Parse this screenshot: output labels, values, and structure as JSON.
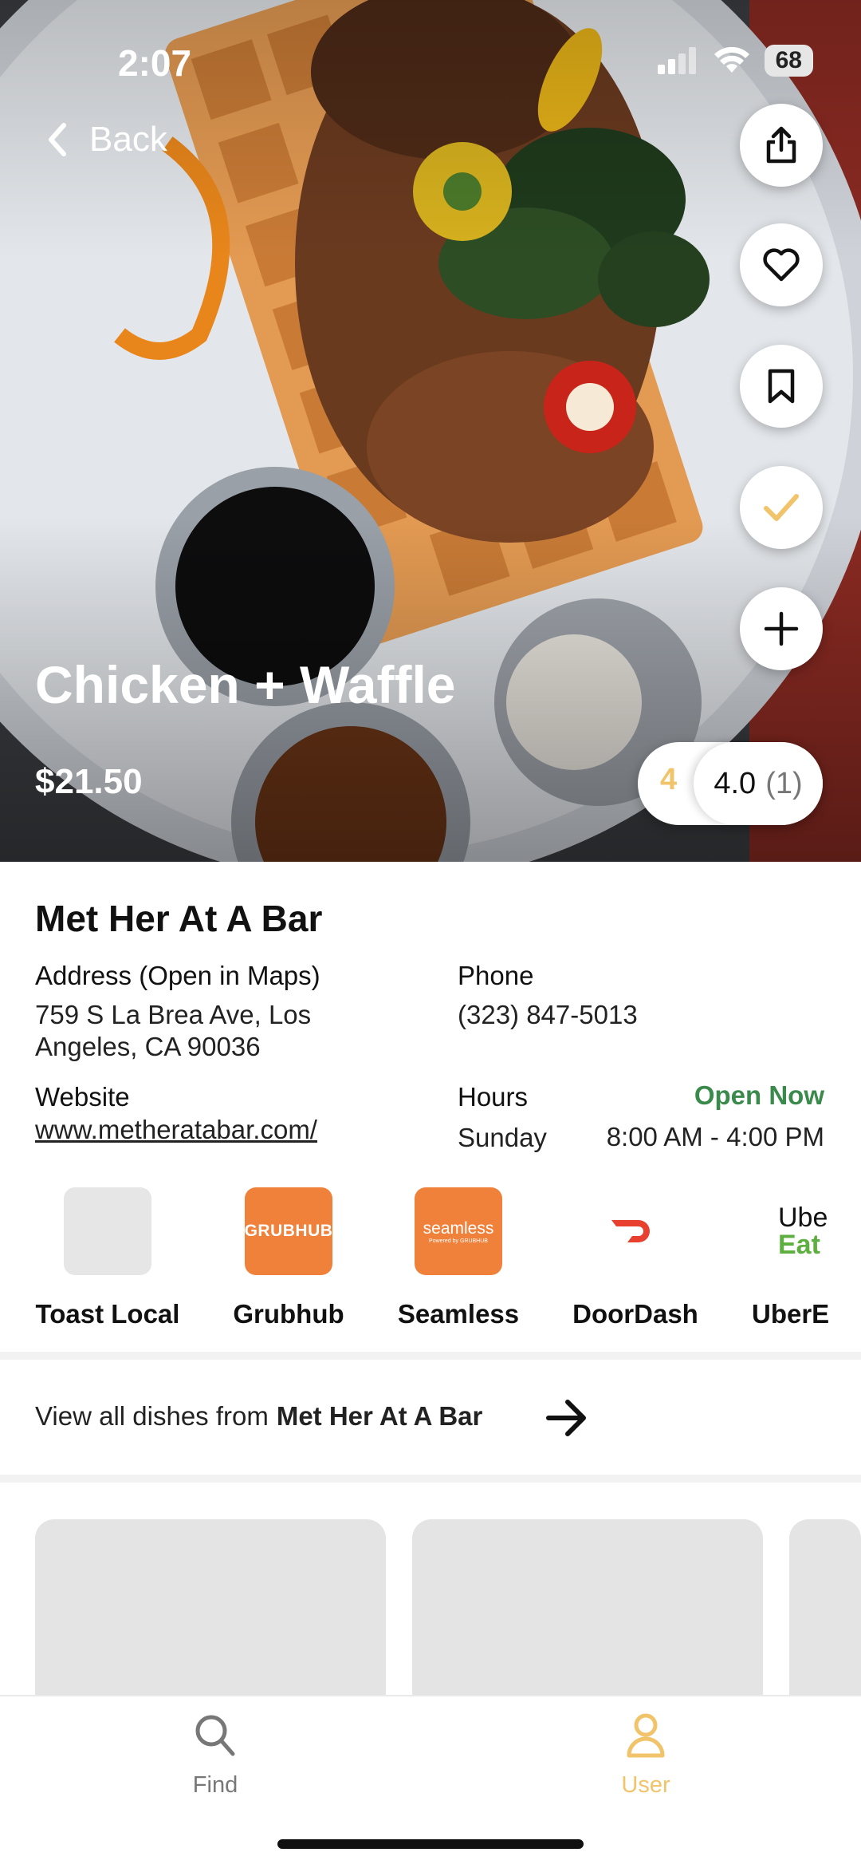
{
  "status_bar": {
    "time": "2:07",
    "battery": "68"
  },
  "nav": {
    "back_label": "Back"
  },
  "dish": {
    "title": "Chicken + Waffle",
    "price": "$21.50"
  },
  "rating": {
    "my_rating": "4",
    "average": "4.0",
    "count": "(1)"
  },
  "restaurant": {
    "name": "Met Her At A Bar",
    "address_label": "Address (Open in Maps)",
    "address_line1": "759 S La Brea Ave, Los",
    "address_line2": "Angeles, CA 90036",
    "phone_label": "Phone",
    "phone": "(323) 847-5013",
    "website_label": "Website",
    "website": "www.metheratabar.com/",
    "hours_label": "Hours",
    "open_status": "Open Now",
    "hours_day": "Sunday",
    "hours_time": "8:00 AM - 4:00 PM"
  },
  "delivery": [
    {
      "name": "Toast Local",
      "logo": ""
    },
    {
      "name": "Grubhub",
      "logo": "GRUBHUB"
    },
    {
      "name": "Seamless",
      "logo": "seamless",
      "logo_sub": "Powered by GRUBHUB"
    },
    {
      "name": "DoorDash",
      "logo": ""
    },
    {
      "name": "UberE",
      "logo_line1": "Ube",
      "logo_line2": "Eat"
    }
  ],
  "view_all": {
    "prefix": "View all dishes from",
    "restaurant": "Met Her At A Bar"
  },
  "tabs": [
    {
      "label": "Find",
      "icon": "search-icon"
    },
    {
      "label": "User",
      "icon": "user-icon"
    }
  ],
  "colors": {
    "accent": "#f1c36a",
    "open_green": "#3a8a4c",
    "grubhub": "#f0813a",
    "doordash": "#e8402f",
    "uber_green": "#5db03f"
  }
}
